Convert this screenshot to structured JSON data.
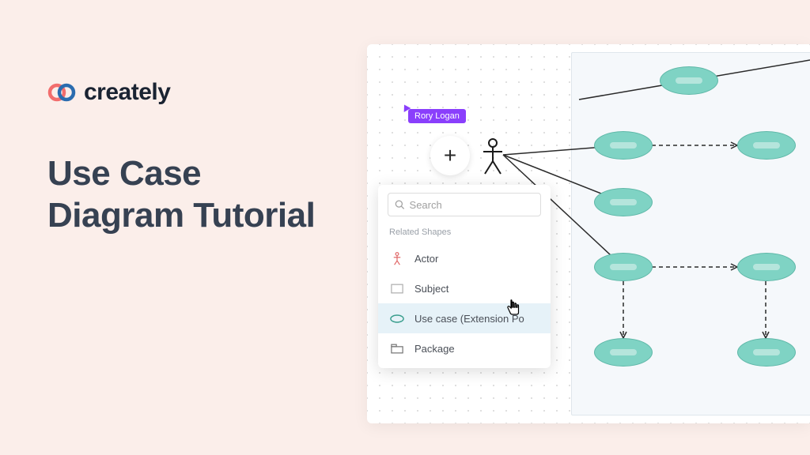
{
  "brand": {
    "name": "creately"
  },
  "headline_line1": "Use Case",
  "headline_line2": "Diagram Tutorial",
  "collaborator": {
    "name": "Rory Logan"
  },
  "shapes_panel": {
    "search_placeholder": "Search",
    "section_label": "Related Shapes",
    "items": [
      {
        "label": "Actor"
      },
      {
        "label": "Subject"
      },
      {
        "label": "Use case (Extension Po"
      },
      {
        "label": "Package"
      }
    ]
  },
  "colors": {
    "bg": "#fbeeea",
    "ink": "#364152",
    "accent": "#8a3ffc",
    "node_fill": "#7fd3c4",
    "node_stroke": "#5fb8a8"
  }
}
